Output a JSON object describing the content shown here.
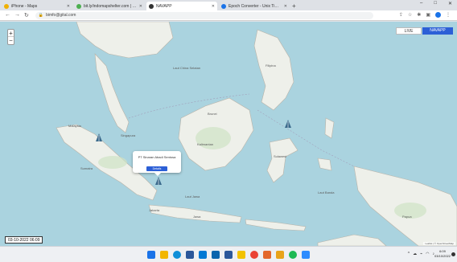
{
  "browser": {
    "tabs": [
      {
        "label": "iPhone - Maps",
        "fav_color": "#f0b000",
        "active": false
      },
      {
        "label": "bit.ly/indomapshelter.com | loadin...",
        "fav_color": "#4caf50",
        "active": false
      },
      {
        "label": "NAVAPP",
        "fav_color": "#333333",
        "active": true
      },
      {
        "label": "Epoch Converter - Unix Timesta...",
        "fav_color": "#1a73e8",
        "active": false
      }
    ],
    "new_tab": "+",
    "url": "bimfo@gital.com",
    "window_controls": {
      "minimize": "–",
      "maximize": "□",
      "close": "✕"
    }
  },
  "map": {
    "zoom_in": "+",
    "zoom_out": "−",
    "live_label": "LIVE",
    "navapp_label": "NAVAPP",
    "popup": {
      "name": "PT Sinaran Abadi Sentosa",
      "button": "Details"
    },
    "labels": [
      {
        "text": "Malaysia"
      },
      {
        "text": "Singapura"
      },
      {
        "text": "Brunei"
      },
      {
        "text": "Filipina"
      },
      {
        "text": "Kalimantan"
      },
      {
        "text": "Sulawesi"
      },
      {
        "text": "Sumatra"
      },
      {
        "text": "Jakarta"
      },
      {
        "text": "Jawa"
      },
      {
        "text": "Papua"
      },
      {
        "text": "Laut Banda"
      },
      {
        "text": "Laut Jawa"
      },
      {
        "text": "Laut China Selatan"
      }
    ],
    "attribution": "Leaflet | © OpenStreetMap"
  },
  "timestamp": "03-10-2022 06:09",
  "taskbar": {
    "icons": [
      {
        "name": "windows-icon",
        "color": "#1a73e8"
      },
      {
        "name": "explorer-icon",
        "color": "#f2b600"
      },
      {
        "name": "edge-icon",
        "color": "#0f8fd8"
      },
      {
        "name": "store-icon",
        "color": "#2b579a"
      },
      {
        "name": "mail-icon",
        "color": "#0078d4"
      },
      {
        "name": "outlook-icon",
        "color": "#0a64ad"
      },
      {
        "name": "word-icon",
        "color": "#2b579a"
      },
      {
        "name": "folder-icon",
        "color": "#f2c200"
      },
      {
        "name": "chrome-icon",
        "color": "#ea4335"
      },
      {
        "name": "excel-icon",
        "color": "#e3672b"
      },
      {
        "name": "photos-icon",
        "color": "#e8a31a"
      },
      {
        "name": "spotify-icon",
        "color": "#1db954"
      },
      {
        "name": "zoom-icon",
        "color": "#2d8cff"
      }
    ],
    "clock_time": "6:09",
    "clock_date": "03/10/2022"
  }
}
